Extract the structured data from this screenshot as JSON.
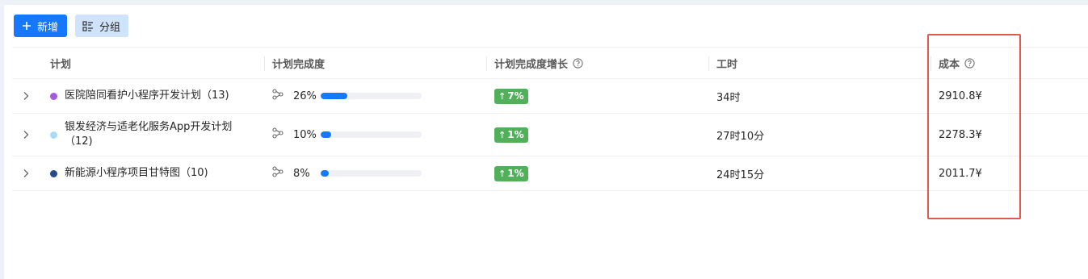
{
  "toolbar": {
    "add_label": "新增",
    "group_label": "分组"
  },
  "table": {
    "columns": {
      "plan": "计划",
      "progress": "计划完成度",
      "growth": "计划完成度增长",
      "hours": "工时",
      "cost": "成本"
    },
    "rows": [
      {
        "name": "医院陪同看护小程序开发计划（13)",
        "dot_color": "#a259e0",
        "progress_text": "26%",
        "progress_value": 0.26,
        "growth": "7%",
        "hours": "34时",
        "cost": "2910.8¥"
      },
      {
        "name": "银发经济与适老化服务App开发计划（12)",
        "dot_color": "#a8dcf5",
        "progress_text": "10%",
        "progress_value": 0.1,
        "growth": "1%",
        "hours": "27时10分",
        "cost": "2278.3¥"
      },
      {
        "name": "新能源小程序项目甘特图（10)",
        "dot_color": "#244b8c",
        "progress_text": "8%",
        "progress_value": 0.08,
        "growth": "1%",
        "hours": "24时15分",
        "cost": "2011.7¥"
      }
    ]
  },
  "colors": {
    "primary": "#1677ff",
    "growth_badge": "#52b05a",
    "highlight_box": "#e05a4f"
  },
  "icons": {
    "add": "plus-icon",
    "group": "group-list-icon",
    "help": "question-circle-icon",
    "expand": "chevron-right-icon",
    "subtask": "branch-icon",
    "growth": "arrow-up-icon"
  }
}
